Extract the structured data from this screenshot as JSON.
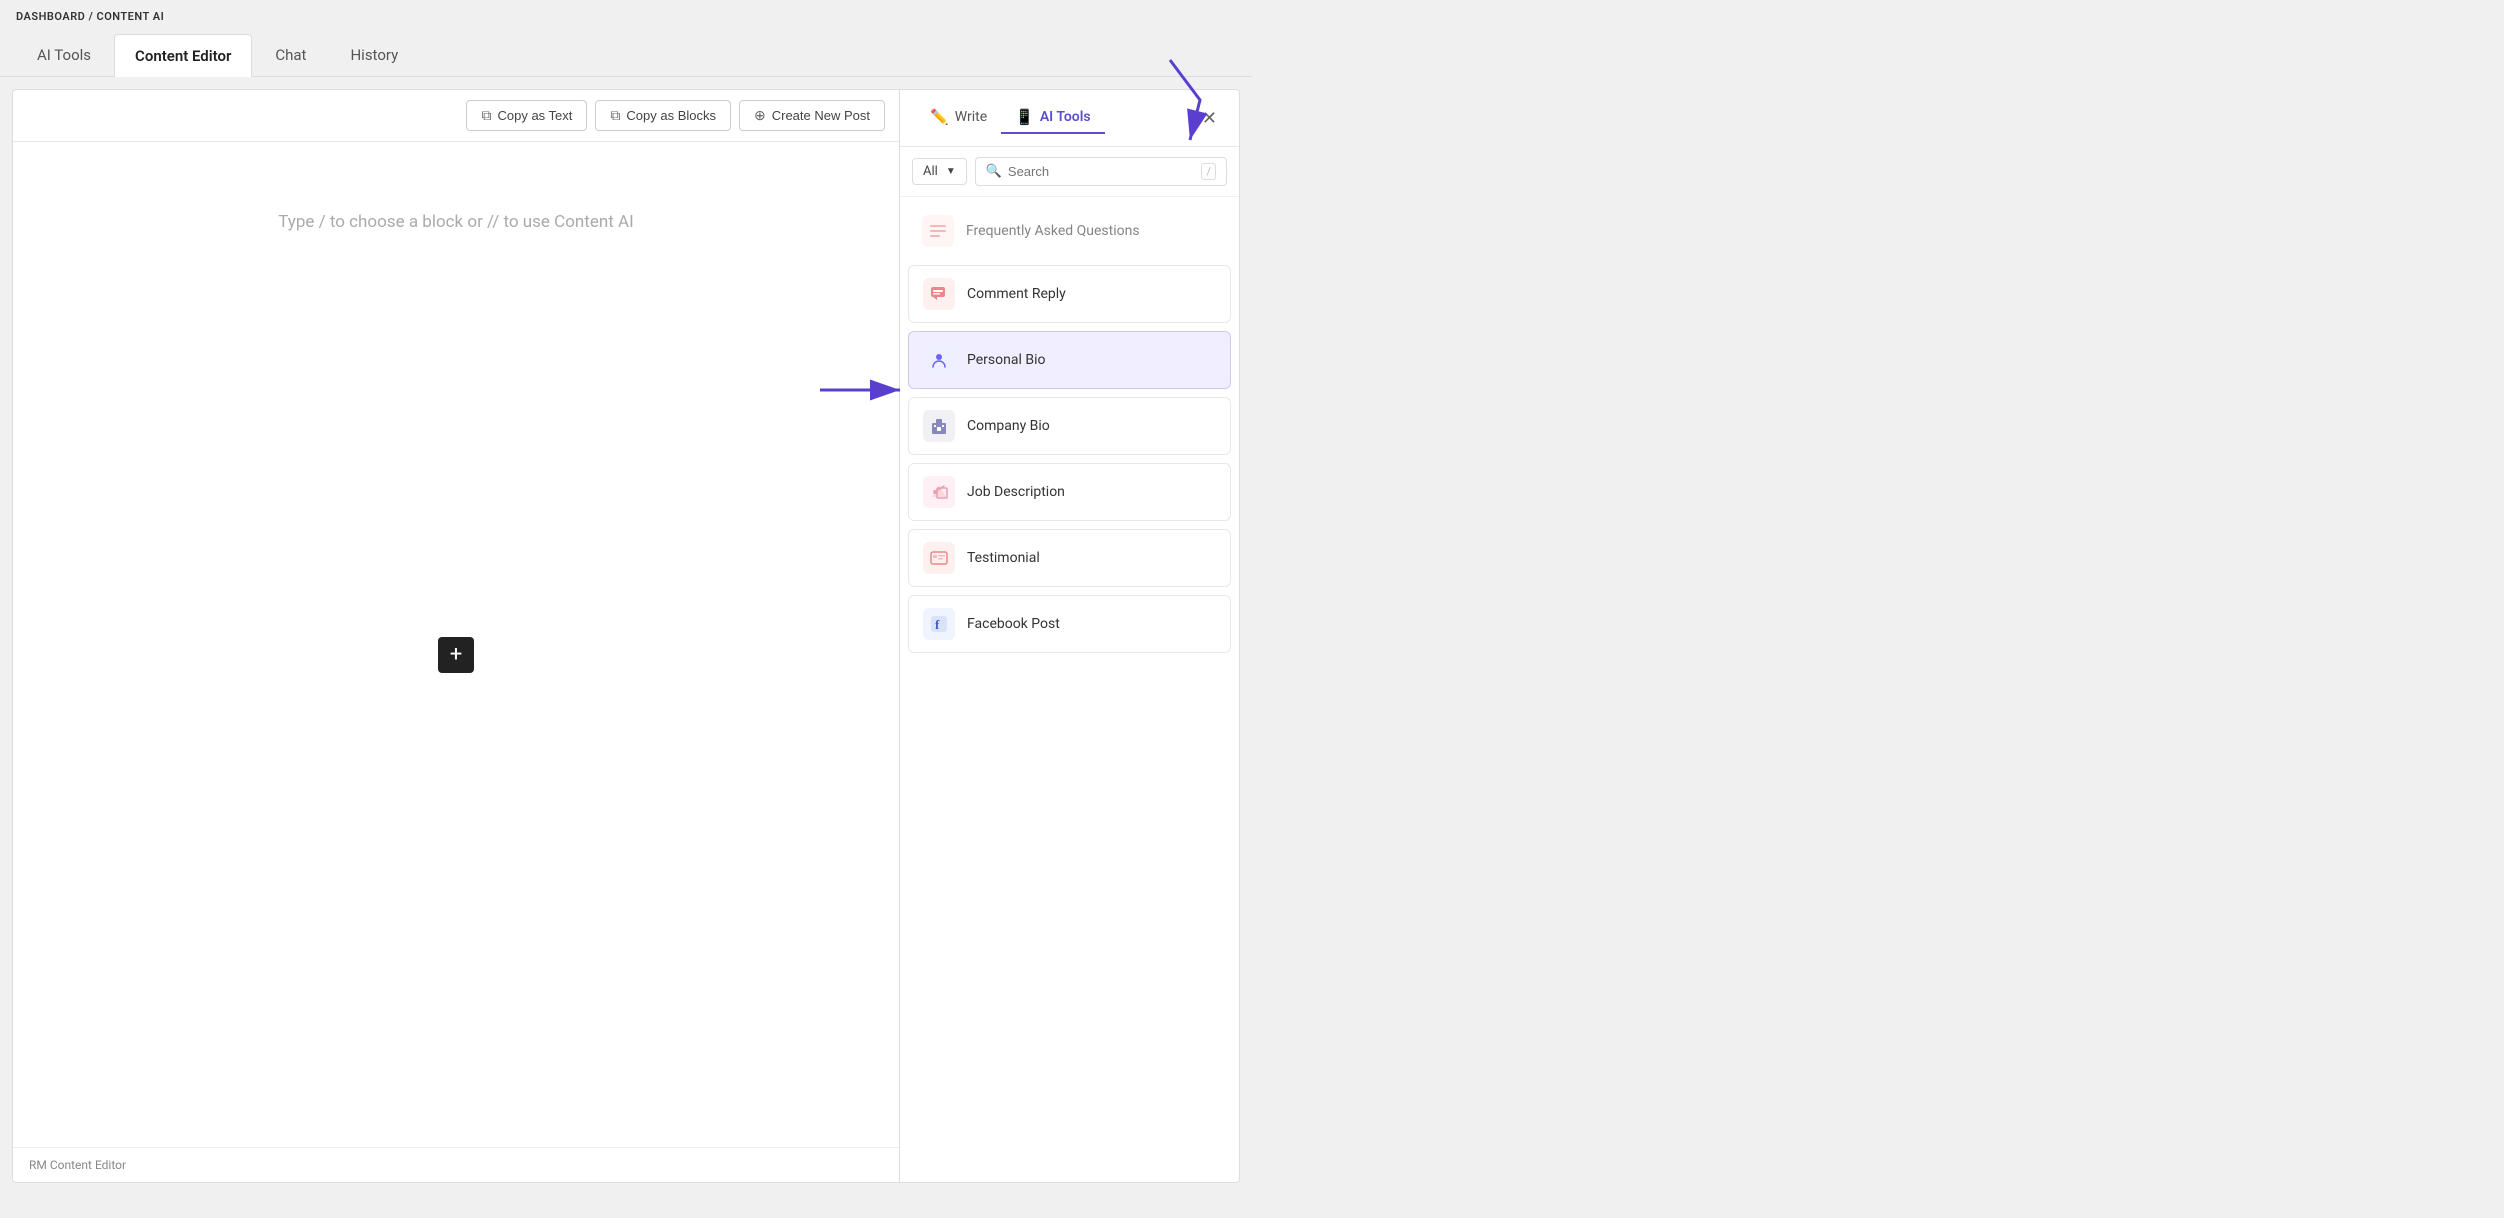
{
  "breadcrumb": {
    "parent": "DASHBOARD",
    "separator": "/",
    "current": "CONTENT AI"
  },
  "tabs": [
    {
      "id": "ai-tools",
      "label": "AI Tools",
      "active": false
    },
    {
      "id": "content-editor",
      "label": "Content Editor",
      "active": true
    },
    {
      "id": "chat",
      "label": "Chat",
      "active": false
    },
    {
      "id": "history",
      "label": "History",
      "active": false
    }
  ],
  "toolbar": {
    "copy_text_label": "Copy as Text",
    "copy_blocks_label": "Copy as Blocks",
    "create_post_label": "Create New Post"
  },
  "editor": {
    "placeholder": "Type / to choose a block or // to use Content AI",
    "footer": "RM Content Editor"
  },
  "ai_panel": {
    "write_tab": "Write",
    "ai_tools_tab": "AI Tools",
    "filter_label": "All",
    "search_placeholder": "Search",
    "tools": [
      {
        "id": "faq",
        "label": "Frequently Asked Questions",
        "icon_type": "faq",
        "icon_char": "≡"
      },
      {
        "id": "comment-reply",
        "label": "Comment Reply",
        "icon_type": "comment",
        "icon_char": "💬"
      },
      {
        "id": "personal-bio",
        "label": "Personal Bio",
        "icon_type": "personal",
        "icon_char": "👤",
        "highlighted": true
      },
      {
        "id": "company-bio",
        "label": "Company Bio",
        "icon_type": "company",
        "icon_char": "🏢"
      },
      {
        "id": "job-description",
        "label": "Job Description",
        "icon_type": "job",
        "icon_char": "📢"
      },
      {
        "id": "testimonial",
        "label": "Testimonial",
        "icon_type": "testimonial",
        "icon_char": "💳"
      },
      {
        "id": "facebook-post",
        "label": "Facebook Post",
        "icon_type": "facebook",
        "icon_char": "f"
      }
    ]
  }
}
